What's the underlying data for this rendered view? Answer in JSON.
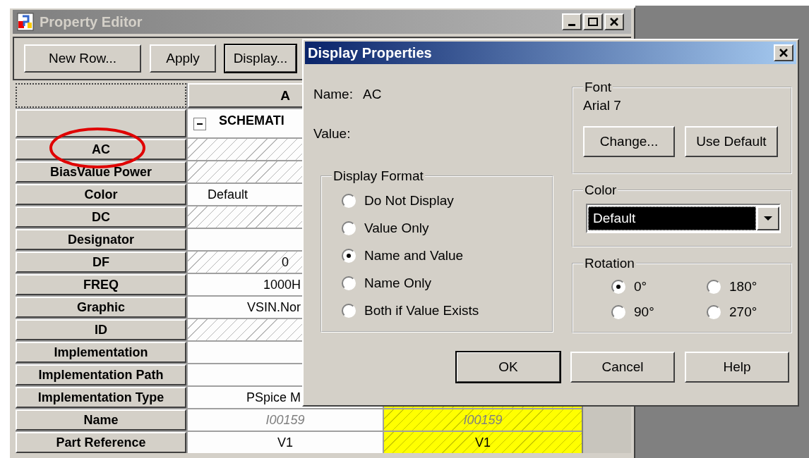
{
  "property_editor": {
    "title": "Property Editor",
    "toolbar": [
      {
        "label": "New Row...",
        "default": false
      },
      {
        "label": "Apply",
        "default": false
      },
      {
        "label": "Display...",
        "default": true
      }
    ],
    "column_a": {
      "label": "A"
    },
    "group": {
      "label": "SCHEMATI",
      "expanded": true
    },
    "rows": [
      {
        "name": "AC",
        "a": {
          "hatched": true
        }
      },
      {
        "name": "BiasValue Power",
        "a": {
          "hatched": true
        }
      },
      {
        "name": "Color",
        "a": {
          "value": "Default",
          "left_aligned": true,
          "hatched": false
        }
      },
      {
        "name": "DC",
        "a": {
          "hatched": true
        }
      },
      {
        "name": "Designator",
        "a": {
          "hatched": false
        }
      },
      {
        "name": "DF",
        "a": {
          "value": "0",
          "hatched": true
        }
      },
      {
        "name": "FREQ",
        "a": {
          "value": "1000H",
          "clipped": true,
          "hatched": false
        }
      },
      {
        "name": "Graphic",
        "a": {
          "value": "VSIN.Nor",
          "clipped": true,
          "hatched": false
        }
      },
      {
        "name": "ID",
        "a": {
          "hatched": true
        }
      },
      {
        "name": "Implementation",
        "a": {
          "hatched": false
        }
      },
      {
        "name": "Implementation Path",
        "a": {
          "hatched": false
        }
      },
      {
        "name": "Implementation Type",
        "a": {
          "value": "PSpice M",
          "clipped": true,
          "hatched": false
        }
      },
      {
        "name": "Name",
        "a": {
          "value": "I00159",
          "hatched": false,
          "italic": true
        },
        "b": {
          "value": "I00159",
          "italic": true
        }
      },
      {
        "name": "Part Reference",
        "a": {
          "value": "V1",
          "hatched": false,
          "italic": false
        },
        "b": {
          "value": "V1",
          "italic": false
        }
      }
    ]
  },
  "dialog": {
    "title": "Display Properties",
    "name_label": "Name:",
    "name_value": "AC",
    "value_label": "Value:",
    "display_format": {
      "title": "Display Format",
      "options": [
        {
          "label": "Do Not Display",
          "selected": false
        },
        {
          "label": "Value Only",
          "selected": false
        },
        {
          "label": "Name and Value",
          "selected": true
        },
        {
          "label": "Name Only",
          "selected": false
        },
        {
          "label": "Both if Value Exists",
          "selected": false
        }
      ]
    },
    "font": {
      "title": "Font",
      "current": "Arial 7",
      "buttons": [
        "Change...",
        "Use Default"
      ]
    },
    "color": {
      "title": "Color",
      "value": "Default"
    },
    "rotation": {
      "title": "Rotation",
      "options": [
        {
          "label": "0°",
          "selected": true
        },
        {
          "label": "180°",
          "selected": false
        },
        {
          "label": "90°",
          "selected": false
        },
        {
          "label": "270°",
          "selected": false
        }
      ]
    },
    "buttons": [
      {
        "label": "OK",
        "default": true
      },
      {
        "label": "Cancel",
        "default": false
      },
      {
        "label": "Help",
        "default": false
      }
    ]
  }
}
